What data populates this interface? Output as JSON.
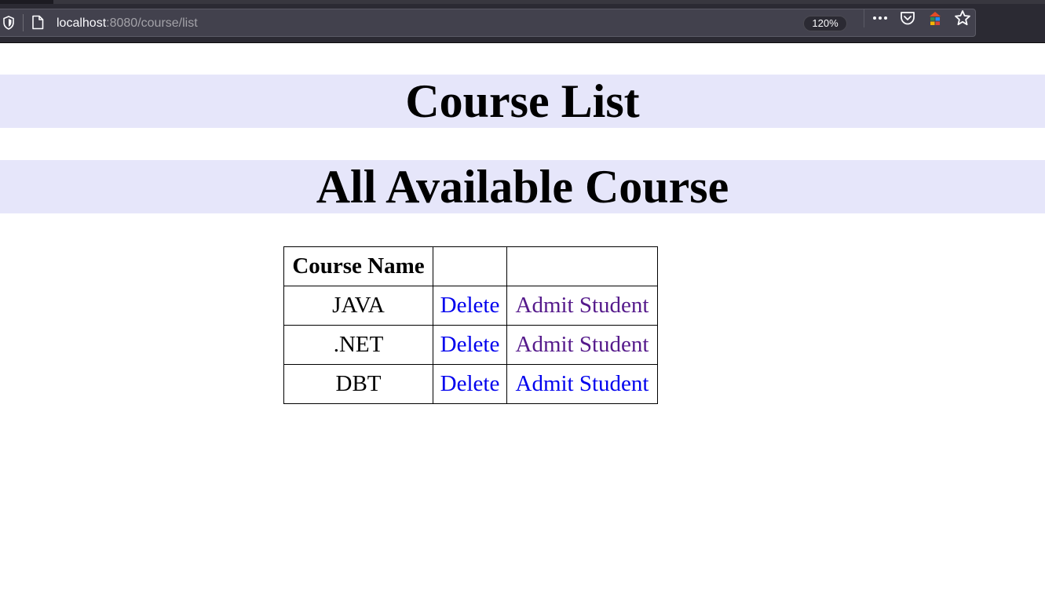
{
  "browser": {
    "url_host": "localhost",
    "url_path": ":8080/course/list",
    "zoom": "120%",
    "colors": {
      "toolbar": "#2b2a33",
      "urlbar": "#42414d"
    },
    "icons": [
      "shield-icon",
      "page-icon",
      "more-icon",
      "pocket-icon",
      "extension-icon",
      "bookmark-star-icon"
    ]
  },
  "page": {
    "title": "Course List",
    "subtitle": "All Available Course",
    "heading_bg": "#e6e6fa"
  },
  "table": {
    "headers": [
      "Course Name",
      "",
      ""
    ],
    "rows": [
      {
        "name": "JAVA",
        "delete_label": "Delete",
        "admit_label": "Admit Student",
        "admit_visited": true
      },
      {
        "name": ".NET",
        "delete_label": "Delete",
        "admit_label": "Admit Student",
        "admit_visited": true
      },
      {
        "name": "DBT",
        "delete_label": "Delete",
        "admit_label": "Admit Student",
        "admit_visited": false
      }
    ],
    "link_colors": {
      "unvisited": "#0000ee",
      "visited": "#551a8b"
    }
  }
}
